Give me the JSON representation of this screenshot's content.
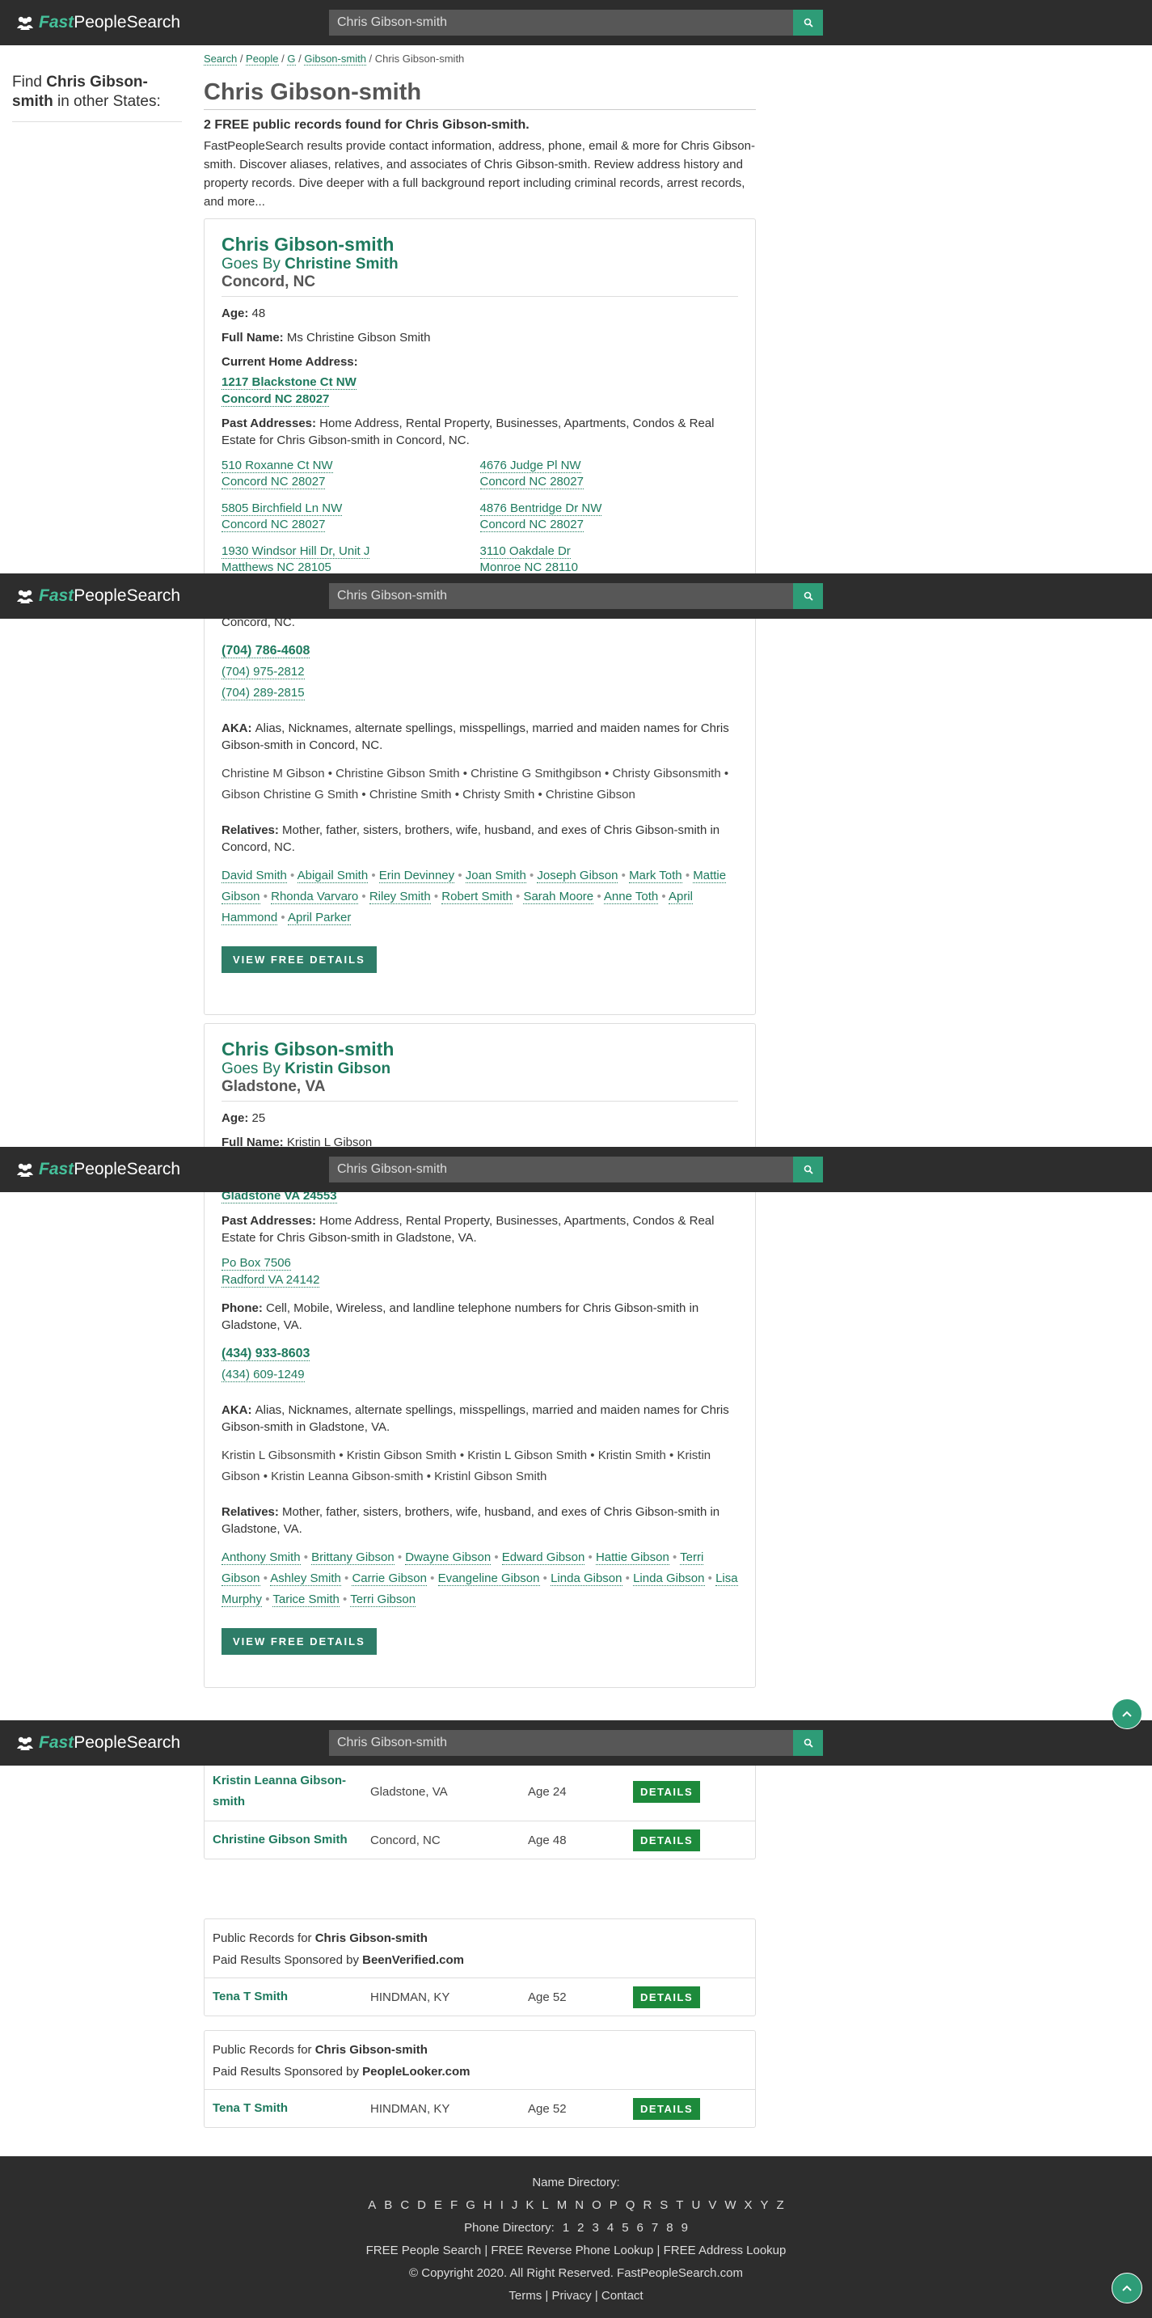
{
  "header": {
    "logo_fast": "Fast",
    "logo_rest": "PeopleSearch",
    "search_value": "Chris Gibson-smith"
  },
  "sidebar": {
    "pre": "Find ",
    "name": "Chris Gibson-smith",
    "post": " in other States:"
  },
  "breadcrumb": {
    "items": [
      "Search",
      "People",
      "G",
      "Gibson-smith"
    ],
    "current": "Chris Gibson-smith"
  },
  "page_title": "Chris Gibson-smith",
  "summary": "2 FREE public records found for Chris Gibson-smith.",
  "intro": "FastPeopleSearch results provide contact information, address, phone, email & more for Chris Gibson-smith. Discover aliases, relatives, and associates of Chris Gibson-smith. Review address history and property records. Dive deeper with a full background report including criminal records, arrest records, and more...",
  "card1": {
    "name": "Chris Gibson-smith",
    "goes_by_prefix": "Goes By ",
    "goes_by": "Christine Smith",
    "location": "Concord, NC",
    "age_label": "Age:",
    "age": "48",
    "fullname_label": "Full Name:",
    "fullname": "Ms Christine Gibson Smith",
    "current_label": "Current Home Address:",
    "current_line1": "1217 Blackstone Ct NW",
    "current_line2": "Concord NC 28027",
    "past_label": "Past Addresses:",
    "past_desc": "Home Address, Rental Property, Businesses, Apartments, Condos & Real Estate for Chris Gibson-smith in Concord, NC.",
    "past": [
      {
        "l1": "510 Roxanne Ct NW",
        "l2": "Concord NC 28027"
      },
      {
        "l1": "4676 Judge Pl NW",
        "l2": "Concord NC 28027"
      },
      {
        "l1": "5805 Birchfield Ln NW",
        "l2": "Concord NC 28027"
      },
      {
        "l1": "4876 Bentridge Dr NW",
        "l2": "Concord NC 28027"
      },
      {
        "l1": "1930 Windsor Hill Dr, Unit J",
        "l2": "Matthews NC 28105"
      },
      {
        "l1": "3110 Oakdale Dr",
        "l2": "Monroe NC 28110"
      }
    ],
    "phone_partial": "Concord, NC.",
    "phones": [
      "(704) 786-4608",
      "(704) 975-2812",
      "(704) 289-2815"
    ],
    "aka_label": "AKA:",
    "aka_desc": "Alias, Nicknames, alternate spellings, misspellings, married and maiden names for Chris Gibson-smith in Concord, NC.",
    "aka": [
      "Christine M Gibson",
      "Christine Gibson Smith",
      "Christine G Smithgibson",
      "Christy Gibsonsmith",
      "Gibson Christine G Smith",
      "Christine Smith",
      "Christy Smith",
      "Christine Gibson"
    ],
    "rel_label": "Relatives:",
    "rel_desc": "Mother, father, sisters, brothers, wife, husband, and exes of Chris Gibson-smith in Concord, NC.",
    "relatives": [
      "David Smith",
      "Abigail Smith",
      "Erin Devinney",
      "Joan Smith",
      "Joseph Gibson",
      "Mark Toth",
      "Mattie Gibson",
      "Rhonda Varvaro",
      "Riley Smith",
      "Robert Smith",
      "Sarah Moore",
      "Anne Toth",
      "April Hammond",
      "April Parker"
    ],
    "button": "VIEW FREE DETAILS"
  },
  "card2": {
    "name": "Chris Gibson-smith",
    "goes_by_prefix": "Goes By ",
    "goes_by": "Kristin Gibson",
    "location": "Gladstone, VA",
    "age_label": "Age:",
    "age": "25",
    "fullname_label": "Full Name:",
    "fullname": "Kristin L Gibson",
    "current_line2": "Gladstone VA 24553",
    "past_label": "Past Addresses:",
    "past_desc": "Home Address, Rental Property, Businesses, Apartments, Condos & Real Estate for Chris Gibson-smith in Gladstone, VA.",
    "past": [
      {
        "l1": "Po Box 7506",
        "l2": "Radford VA 24142"
      }
    ],
    "phone_label": "Phone:",
    "phone_desc": "Cell, Mobile, Wireless, and landline telephone numbers for Chris Gibson-smith in Gladstone, VA.",
    "phones": [
      "(434) 933-8603",
      "(434) 609-1249"
    ],
    "aka_label": "AKA:",
    "aka_desc": "Alias, Nicknames, alternate spellings, misspellings, married and maiden names for Chris Gibson-smith in Gladstone, VA.",
    "aka": [
      "Kristin L Gibsonsmith",
      "Kristin Gibson Smith",
      "Kristin L Gibson Smith",
      "Kristin Smith",
      "Kristin Gibson",
      "Kristin Leanna Gibson-smith",
      "Kristinl Gibson Smith"
    ],
    "rel_label": "Relatives:",
    "rel_desc": "Mother, father, sisters, brothers, wife, husband, and exes of Chris Gibson-smith in Gladstone, VA.",
    "relatives": [
      "Anthony Smith",
      "Brittany Gibson",
      "Dwayne Gibson",
      "Edward Gibson",
      "Hattie Gibson",
      "Terri Gibson",
      "Ashley Smith",
      "Carrie Gibson",
      "Evangeline Gibson",
      "Linda Gibson",
      "Linda Gibson",
      "Lisa Murphy",
      "Tarice Smith",
      "Terri Gibson"
    ],
    "button": "VIEW FREE DETAILS"
  },
  "results1": [
    {
      "name": "Kristin Leanna Gibson-smith",
      "city": "Gladstone, VA",
      "age": "Age 24",
      "btn": "DETAILS"
    },
    {
      "name": "Christine Gibson Smith",
      "city": "Concord, NC",
      "age": "Age 48",
      "btn": "DETAILS"
    }
  ],
  "sponsored1": {
    "pre": "Public Records for ",
    "name": "Chris Gibson-smith",
    "sponsor_pre": "Paid Results Sponsored by ",
    "sponsor": "BeenVerified.com",
    "row": {
      "name": "Tena T Smith",
      "city": "HINDMAN, KY",
      "age": "Age 52",
      "btn": "DETAILS"
    }
  },
  "sponsored2": {
    "pre": "Public Records for ",
    "name": "Chris Gibson-smith",
    "sponsor_pre": "Paid Results Sponsored by ",
    "sponsor": "PeopleLooker.com",
    "row": {
      "name": "Tena T Smith",
      "city": "HINDMAN, KY",
      "age": "Age 52",
      "btn": "DETAILS"
    }
  },
  "footer": {
    "name_dir": "Name Directory:",
    "letters": [
      "A",
      "B",
      "C",
      "D",
      "E",
      "F",
      "G",
      "H",
      "I",
      "J",
      "K",
      "L",
      "M",
      "N",
      "O",
      "P",
      "Q",
      "R",
      "S",
      "T",
      "U",
      "V",
      "W",
      "X",
      "Y",
      "Z"
    ],
    "phone_dir": "Phone Directory:",
    "digits": [
      "1",
      "2",
      "3",
      "4",
      "5",
      "6",
      "7",
      "8",
      "9"
    ],
    "links": [
      "FREE People Search",
      "FREE Reverse Phone Lookup",
      "FREE Address Lookup"
    ],
    "copyright": "© Copyright 2020. All Right Reserved. FastPeopleSearch.com",
    "bottom": [
      "Terms",
      "Privacy",
      "Contact"
    ]
  }
}
